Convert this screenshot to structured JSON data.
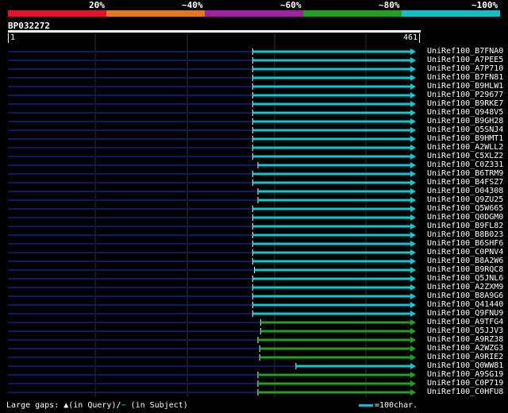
{
  "legend": {
    "labels": [
      "20%",
      "~40%",
      "~60%",
      "~80%",
      "~100%"
    ],
    "colors": [
      "#e8102a",
      "#e87820",
      "#a020a0",
      "#20a020",
      "#10c0c8"
    ]
  },
  "query": {
    "id": "BP032272",
    "start": "1",
    "end": "461",
    "length": 461
  },
  "colors": {
    "cyan": "#10c8d0",
    "green": "#20a020",
    "navy": "#101860",
    "grid": "#303030"
  },
  "hits": [
    {
      "label": "UniRef100_B7FNA0",
      "start": 278,
      "color": "cyan"
    },
    {
      "label": "UniRef100_A7PEE5",
      "start": 278,
      "color": "cyan"
    },
    {
      "label": "UniRef100_A7P710",
      "start": 278,
      "color": "cyan"
    },
    {
      "label": "UniRef100_B7FN81",
      "start": 278,
      "color": "cyan"
    },
    {
      "label": "UniRef100_B9HLW1",
      "start": 278,
      "color": "cyan"
    },
    {
      "label": "UniRef100_P29677",
      "start": 278,
      "color": "cyan"
    },
    {
      "label": "UniRef100_B9RKE7",
      "start": 278,
      "color": "cyan"
    },
    {
      "label": "UniRef100_Q948V5",
      "start": 278,
      "color": "cyan"
    },
    {
      "label": "UniRef100_B9GH28",
      "start": 278,
      "color": "cyan"
    },
    {
      "label": "UniRef100_Q5SNJ4",
      "start": 278,
      "color": "cyan"
    },
    {
      "label": "UniRef100_B9HMT1",
      "start": 278,
      "color": "cyan"
    },
    {
      "label": "UniRef100_A2WLL2",
      "start": 278,
      "color": "cyan"
    },
    {
      "label": "UniRef100_C5XLZ2",
      "start": 278,
      "color": "cyan"
    },
    {
      "label": "UniRef100_C0Z331",
      "start": 284,
      "color": "cyan"
    },
    {
      "label": "UniRef100_B6TRM9",
      "start": 278,
      "color": "cyan"
    },
    {
      "label": "UniRef100_B4FSZ7",
      "start": 278,
      "color": "cyan"
    },
    {
      "label": "UniRef100_O04308",
      "start": 284,
      "color": "cyan"
    },
    {
      "label": "UniRef100_Q9ZU25",
      "start": 284,
      "color": "cyan"
    },
    {
      "label": "UniRef100_Q5W665",
      "start": 278,
      "color": "cyan"
    },
    {
      "label": "UniRef100_Q0DGM0",
      "start": 278,
      "color": "cyan"
    },
    {
      "label": "UniRef100_B9FL82",
      "start": 278,
      "color": "cyan"
    },
    {
      "label": "UniRef100_B8B023",
      "start": 278,
      "color": "cyan"
    },
    {
      "label": "UniRef100_B6SHF6",
      "start": 278,
      "color": "cyan"
    },
    {
      "label": "UniRef100_C0PNV4",
      "start": 278,
      "color": "cyan"
    },
    {
      "label": "UniRef100_B8A2W6",
      "start": 278,
      "color": "cyan"
    },
    {
      "label": "UniRef100_B9RQC8",
      "start": 280,
      "color": "cyan"
    },
    {
      "label": "UniRef100_Q5JNL6",
      "start": 278,
      "color": "cyan"
    },
    {
      "label": "UniRef100_A2ZXM9",
      "start": 278,
      "color": "cyan"
    },
    {
      "label": "UniRef100_B8A9G6",
      "start": 278,
      "color": "cyan"
    },
    {
      "label": "UniRef100_Q41440",
      "start": 278,
      "color": "cyan"
    },
    {
      "label": "UniRef100_Q9FNU9",
      "start": 278,
      "color": "cyan"
    },
    {
      "label": "UniRef100_A9TFG4",
      "start": 287,
      "color": "green"
    },
    {
      "label": "UniRef100_Q5JJV3",
      "start": 287,
      "color": "green"
    },
    {
      "label": "UniRef100_A9RZ38",
      "start": 284,
      "color": "green"
    },
    {
      "label": "UniRef100_A2WZG3",
      "start": 286,
      "color": "green"
    },
    {
      "label": "UniRef100_A9RIE2",
      "start": 286,
      "color": "green"
    },
    {
      "label": "UniRef100_Q0WW81",
      "start": 327,
      "color": "cyan"
    },
    {
      "label": "UniRef100_A9SG19",
      "start": 284,
      "color": "green"
    },
    {
      "label": "UniRef100_C0P719",
      "start": 284,
      "color": "green"
    },
    {
      "label": "UniRef100_C0HFU8",
      "start": 284,
      "color": "green"
    }
  ],
  "footer": {
    "gaps_text": "Large gaps: ▲(in Query)/",
    "gaps_subject_symbol": "−",
    "gaps_subject_text": " (in Subject)",
    "scale_text": "=100char."
  }
}
